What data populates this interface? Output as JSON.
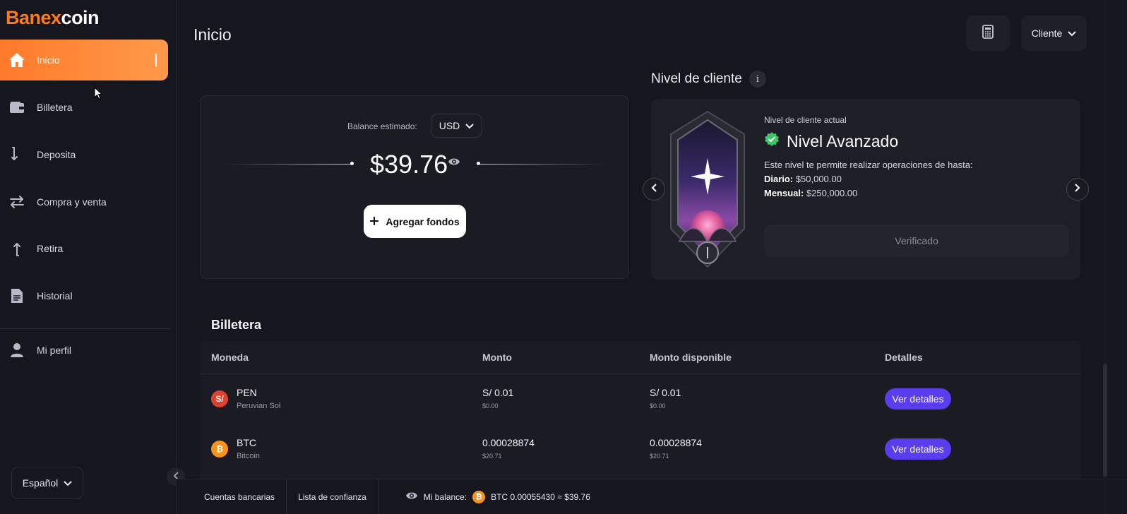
{
  "brand": {
    "part1": "Banex",
    "part2": "coin",
    "accent": "#ff7a1a"
  },
  "sidebar": {
    "items": [
      {
        "label": "Inicio",
        "icon": "home-icon",
        "active": true
      },
      {
        "label": "Billetera",
        "icon": "wallet-icon"
      },
      {
        "label": "Deposita",
        "icon": "deposit-arrow-icon"
      },
      {
        "label": "Compra y venta",
        "icon": "exchange-icon"
      },
      {
        "label": "Retira",
        "icon": "withdraw-arrow-icon"
      },
      {
        "label": "Historial",
        "icon": "document-icon"
      },
      {
        "label": "Mi perfil",
        "icon": "user-icon"
      }
    ],
    "language": "Español"
  },
  "header": {
    "title": "Inicio",
    "client_menu": "Cliente"
  },
  "balance": {
    "label": "Balance estimado:",
    "currency": "USD",
    "amount": "$39.76",
    "add_funds": "Agregar fondos"
  },
  "level": {
    "section_title": "Nivel de cliente",
    "subtitle": "Nivel de cliente actual",
    "name": "Nivel Avanzado",
    "description": "Este nivel te permite realizar operaciones de hasta:",
    "daily_label": "Diario:",
    "daily_value": "$50,000.00",
    "monthly_label": "Mensual:",
    "monthly_value": "$250,000.00",
    "status": "Verificado"
  },
  "wallet": {
    "title": "Billetera",
    "columns": [
      "Moneda",
      "Monto",
      "Monto disponible",
      "Detalles"
    ],
    "rows": [
      {
        "code": "PEN",
        "name": "Peruvian Sol",
        "icon": "S/",
        "color": "#e0412f",
        "amount": "S/ 0.01",
        "amount_usd": "$0.00",
        "available": "S/ 0.01",
        "available_usd": "$0.00",
        "action": "Ver detalles"
      },
      {
        "code": "BTC",
        "name": "Bitcoin",
        "icon": "₿",
        "color": "#f7931a",
        "amount": "0.00028874",
        "amount_usd": "$20.71",
        "available": "0.00028874",
        "available_usd": "$20.71",
        "action": "Ver detalles"
      }
    ]
  },
  "bottom": {
    "bank_accounts": "Cuentas bancarias",
    "trust_list": "Lista de confianza",
    "balance_label": "Mi balance:",
    "balance_value": "BTC 0.00055430 ≈ $39.76"
  }
}
